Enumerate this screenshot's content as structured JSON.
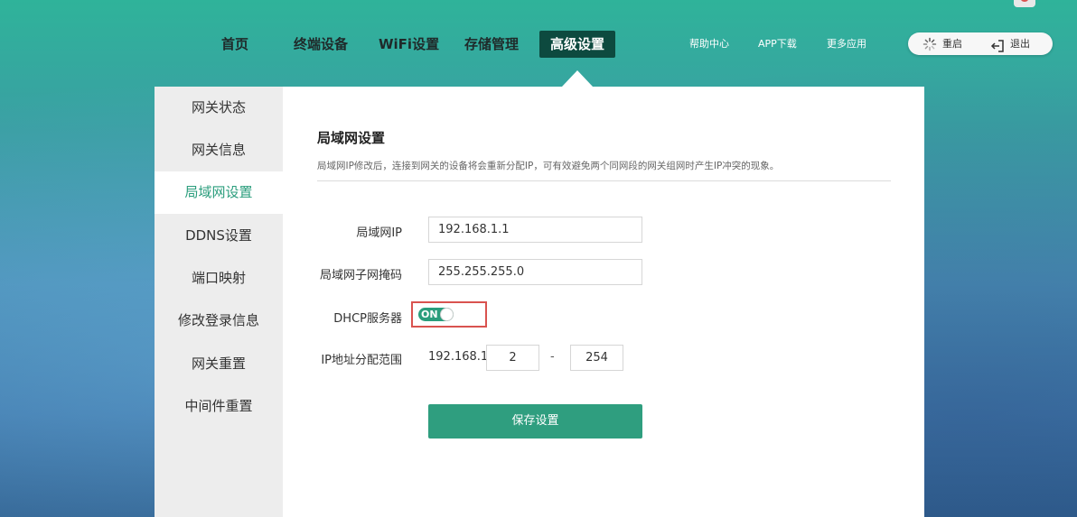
{
  "nav": {
    "items": [
      "首页",
      "终端设备",
      "WiFi设置",
      "存储管理",
      "高级设置"
    ],
    "active_index": 4,
    "links": [
      "帮助中心",
      "APP下载",
      "更多应用"
    ],
    "reboot_label": "重启",
    "logout_label": "退出"
  },
  "sidebar": {
    "items": [
      "网关状态",
      "网关信息",
      "局域网设置",
      "DDNS设置",
      "端口映射",
      "修改登录信息",
      "网关重置",
      "中间件重置"
    ],
    "active_index": 2
  },
  "lan": {
    "title": "局域网设置",
    "description": "局域网IP修改后，连接到网关的设备将会重新分配IP，可有效避免两个同网段的网关组网时产生IP冲突的现象。",
    "ip_label": "局域网IP",
    "ip_value": "192.168.1.1",
    "mask_label": "局域网子网掩码",
    "mask_value": "255.255.255.0",
    "dhcp_label": "DHCP服务器",
    "dhcp_state": "ON",
    "range_label": "IP地址分配范围",
    "range_prefix": "192.168.1.",
    "range_start": "2",
    "range_separator": "-",
    "range_end": "254",
    "save_label": "保存设置"
  },
  "colors": {
    "accent": "#2a9d7c",
    "nav_active": "#0d4a3f",
    "highlight_border": "#d9534f"
  }
}
